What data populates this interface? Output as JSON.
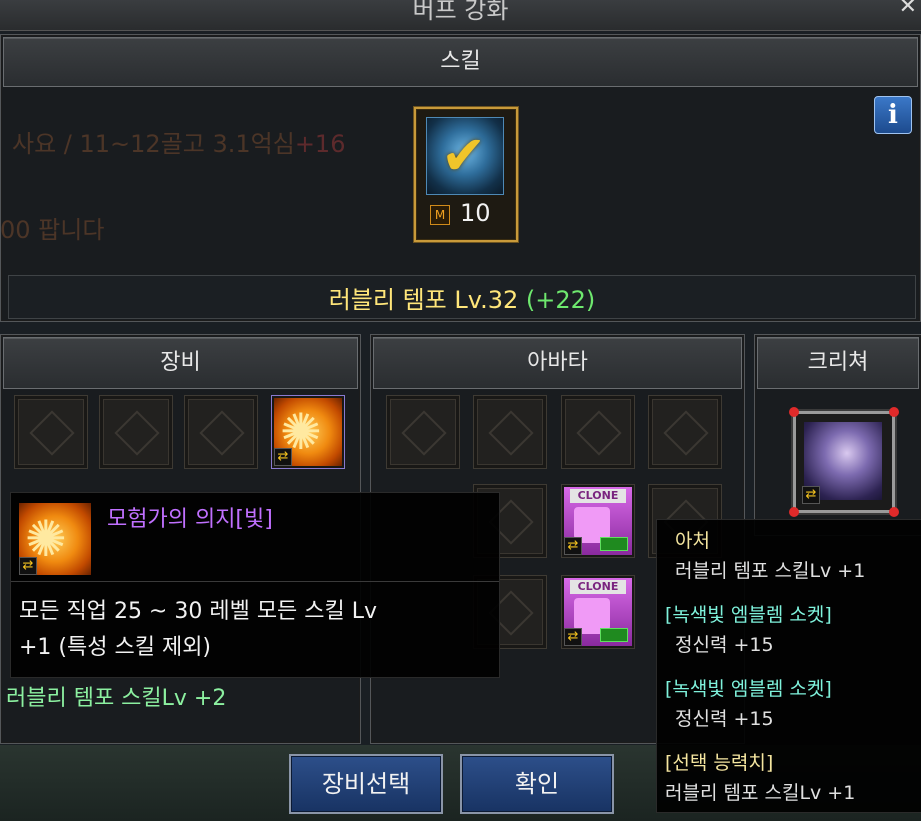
{
  "window": {
    "title": "버프 강화",
    "close_label": "✕"
  },
  "skill_panel": {
    "header": "스킬",
    "skill_icon": "skill-checkmark-icon",
    "badge": "M",
    "count": "10",
    "info_label": "i",
    "skill_name": "러블리 템포 Lv.32",
    "skill_bonus": "(+22)"
  },
  "background_text": {
    "line1": "사요 / 11~12골고 3.1억심",
    "line1_extra": "+16",
    "line2": "00 팝니다"
  },
  "equipment_panel": {
    "header": "장비"
  },
  "avatar_panel": {
    "header": "아바타"
  },
  "creature_panel": {
    "header": "크리쳐"
  },
  "clone_label": "CLONE",
  "equip_tooltip": {
    "name": "모험가의 의지[빛]",
    "description_line1": "모든 직업 25 ~ 30 레벨 모든 스킬 Lv",
    "description_line2": "+1 (특성 스킬 제외)",
    "bonus": "러블리 템포 스킬Lv +2"
  },
  "avatar_tooltip": {
    "slot_name": "아처",
    "slot_bonus": "러블리 템포 스킬Lv +1",
    "socket1_title": "[녹색빛 엠블렘 소켓]",
    "socket1_value": "정신력 +15",
    "socket2_title": "[녹색빛 엠블렘 소켓]",
    "socket2_value": "정신력 +15",
    "option_title": "[선택 능력치]",
    "option_value": "러블리 템포 스킬Lv +1"
  },
  "buttons": {
    "select_equipment": "장비선택",
    "confirm": "확인"
  },
  "colors": {
    "gold": "#ffe67a",
    "green": "#6ee86e",
    "purple": "#c070ff",
    "mint": "#8cf0a0",
    "cyan": "#7ff2dc",
    "yellow_tip": "#f5e6a0"
  }
}
